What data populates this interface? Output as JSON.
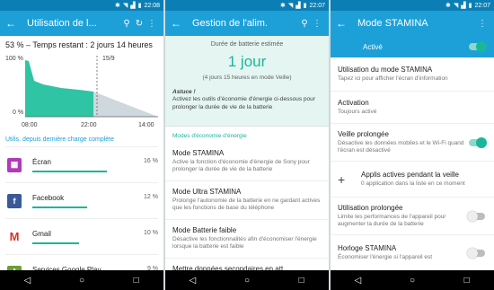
{
  "status": {
    "s1": {
      "time": "22:08"
    },
    "s2": {
      "time": "22:07"
    },
    "s3": {
      "time": "22:07"
    }
  },
  "screen1": {
    "title": "Utilisation de l...",
    "icons": [
      "back-icon",
      "search-icon",
      "refresh-icon",
      "more-icon"
    ],
    "header": "53 % – Temps restant : 2 jours 14 heures",
    "chart": {
      "y_top": "100 %",
      "y_bottom": "0 %",
      "date_marker": "15/9",
      "x_ticks": [
        "08:00",
        "22:00",
        "14:00"
      ]
    },
    "since_link": "Utilis. depuis dernière charge complète",
    "apps": [
      {
        "name": "Écran",
        "pct": "16 %",
        "level": 0.16,
        "icon": "screen-icon",
        "color": "#b03ab7"
      },
      {
        "name": "Facebook",
        "pct": "12 %",
        "level": 0.12,
        "icon": "facebook-icon",
        "color": "#3b5998"
      },
      {
        "name": "Gmail",
        "pct": "10 %",
        "level": 0.1,
        "icon": "gmail-icon",
        "color": "#d93025"
      },
      {
        "name": "Services Google Play",
        "pct": "9 %",
        "level": 0.09,
        "icon": "puzzle-icon",
        "color": "#689f38"
      }
    ]
  },
  "screen2": {
    "title": "Gestion de l'alim.",
    "estimate_label": "Durée de batterie estimée",
    "estimate_value": "1 jour",
    "estimate_sub": "(4 jours 15 heures en mode Veille)",
    "tip_title": "Astuce !",
    "tip_text": "Activez les outils d'économie d'énergie ci-dessous pour prolonger la durée de vie de la batterie",
    "section": "Modes d'économie d'énergie",
    "modes": [
      {
        "title": "Mode STAMINA",
        "desc": "Active la fonction d'économie d'énergie de Sony pour prolonger la durée de vie de la batterie"
      },
      {
        "title": "Mode Ultra STAMINA",
        "desc": "Prolonge l'autonomie de la batterie en ne gardant actives que les fonctions de base du téléphone"
      },
      {
        "title": "Mode Batterie faible",
        "desc": "Désactive les fonctionnalités afin d'économiser l'énergie lorsque la batterie est faible"
      },
      {
        "title": "Mettre données secondaires en att.",
        "desc": ""
      }
    ]
  },
  "screen3": {
    "title": "Mode STAMINA",
    "active_label": "Activé",
    "active_on": true,
    "settings": [
      {
        "title": "Utilisation du mode STAMINA",
        "desc": "Tapez ici pour afficher l'écran d'information",
        "toggle": null
      },
      {
        "title": "Activation",
        "desc": "Toujours activé",
        "toggle": null
      },
      {
        "title": "Veille prolongée",
        "desc": "Désactive les données mobiles et le Wi-Fi quand l'écran est désactivé",
        "toggle": "on"
      },
      {
        "title": "Applis actives pendant la veille",
        "desc": "0 application dans la liste en ce moment",
        "toggle": null,
        "plus": "+"
      },
      {
        "title": "Utilisation prolongée",
        "desc": "Limite les performances de l'appareil pour augmenter la durée de la batterie",
        "toggle": "off"
      },
      {
        "title": "Horloge STAMINA",
        "desc": "Économiser l'énergie si l'appareil est",
        "toggle": "off"
      }
    ]
  },
  "colors": {
    "status_bar": "#0b7fb5",
    "app_bar": "#1da0d8",
    "accent_teal": "#1ab69a",
    "chart_fill": "#2ec4a4",
    "chart_forecast": "#cfd8dc"
  }
}
